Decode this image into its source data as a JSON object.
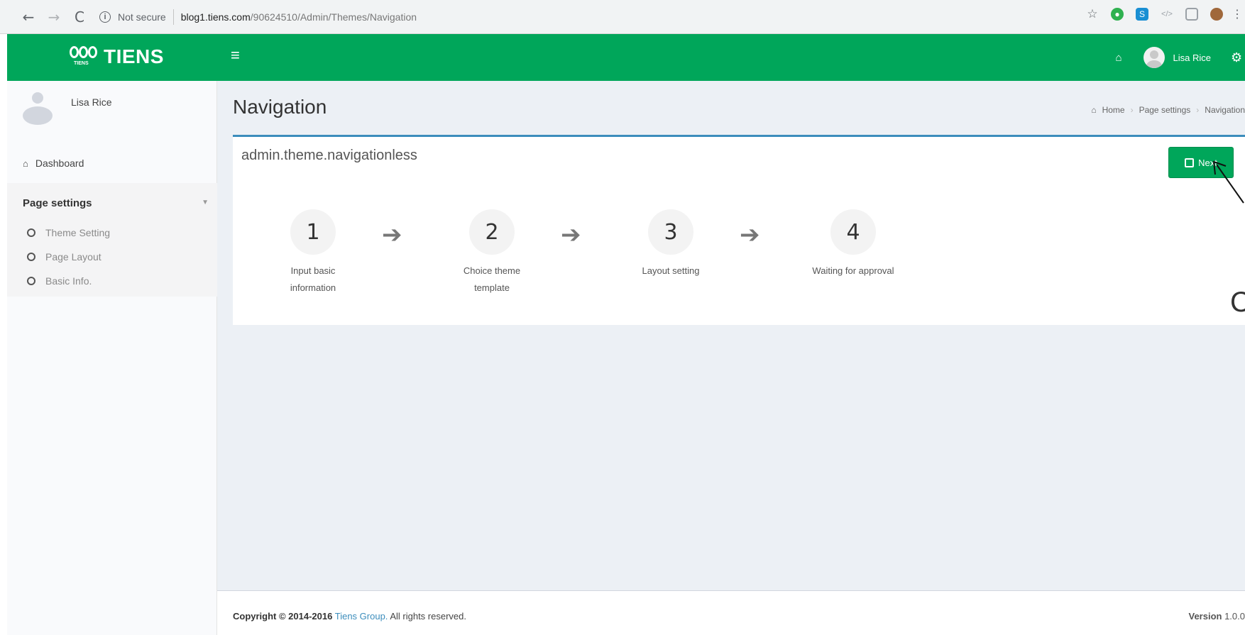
{
  "browser": {
    "back": "←",
    "forward": "→",
    "reload": "C",
    "info_glyph": "i",
    "security_label": "Not secure",
    "url_host": "blog1.tiens.com",
    "url_path": "/90624510/Admin/Themes/Navigation",
    "extension_icons": [
      "star-icon",
      "green-circle-extension-icon",
      "skype-extension-icon",
      "vpn-extension-icon",
      "window-extension-icon",
      "profile-picture-icon",
      "kebab-menu-icon"
    ]
  },
  "header": {
    "logo_text": "TIENS",
    "logo_sub": "TIENS",
    "menu_toggle": "≡",
    "user_name": "Lisa Rice",
    "brand_color": "#00a65a"
  },
  "sidebar": {
    "user_name": "Lisa Rice",
    "dashboard_label": "Dashboard",
    "group_label": "Page settings",
    "items": [
      {
        "label": "Theme Setting"
      },
      {
        "label": "Page Layout"
      },
      {
        "label": "Basic Info."
      }
    ]
  },
  "content": {
    "title": "Navigation",
    "breadcrumb": [
      "Home",
      "Page settings",
      "Navigation"
    ],
    "box_title": "admin.theme.navigationless",
    "next_label": "Next",
    "steps": [
      {
        "num": "1",
        "label": "Input basic information"
      },
      {
        "num": "2",
        "label": "Choice theme template"
      },
      {
        "num": "3",
        "label": "Layout setting"
      },
      {
        "num": "4",
        "label": "Waiting for approval"
      }
    ],
    "step_arrow": "➔",
    "accent_color": "#3c8dbc"
  },
  "footer": {
    "copyright_prefix": "Copyright © 2014-2016",
    "company": "Tiens Group.",
    "rights": "All rights reserved.",
    "version_label": "Version",
    "version_value": "1.0.0"
  },
  "annotation": {
    "callout_letter": "C"
  }
}
